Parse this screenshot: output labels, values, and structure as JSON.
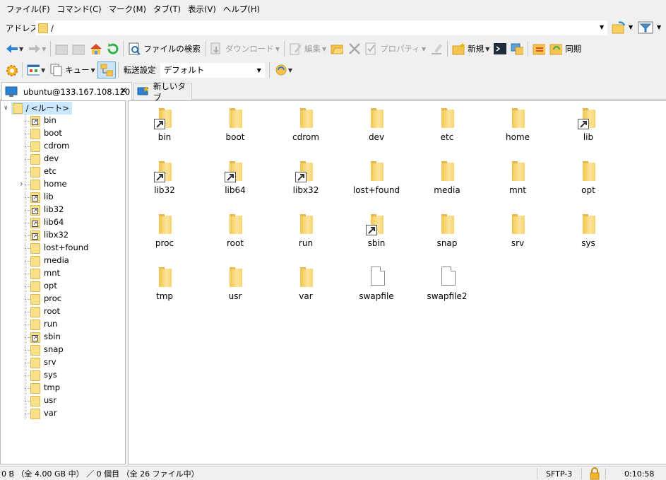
{
  "menu": [
    "ファイル(F)",
    "コマンド(C)",
    "マーク(M)",
    "タブ(T)",
    "表示(V)",
    "ヘルプ(H)"
  ],
  "address": {
    "label": "アドレス",
    "value": "/"
  },
  "toolbar": {
    "find_files": "ファイルの検索",
    "download": "ダウンロード",
    "edit": "編集",
    "properties": "プロパティ",
    "new": "新規",
    "sync": "同期",
    "queue": "キュー",
    "transfer_label": "転送設定",
    "transfer_value": "デフォルト"
  },
  "tabs": [
    {
      "label": "ubuntu@133.167.108.120",
      "active": true
    },
    {
      "label": "新しいタブ",
      "active": false
    }
  ],
  "tree": {
    "root": "/ <ルート>",
    "items": [
      {
        "name": "bin",
        "link": true
      },
      {
        "name": "boot",
        "link": false
      },
      {
        "name": "cdrom",
        "link": false
      },
      {
        "name": "dev",
        "link": false
      },
      {
        "name": "etc",
        "link": false
      },
      {
        "name": "home",
        "link": false,
        "expandable": true
      },
      {
        "name": "lib",
        "link": true
      },
      {
        "name": "lib32",
        "link": true
      },
      {
        "name": "lib64",
        "link": true
      },
      {
        "name": "libx32",
        "link": true
      },
      {
        "name": "lost+found",
        "link": false
      },
      {
        "name": "media",
        "link": false
      },
      {
        "name": "mnt",
        "link": false
      },
      {
        "name": "opt",
        "link": false
      },
      {
        "name": "proc",
        "link": false
      },
      {
        "name": "root",
        "link": false
      },
      {
        "name": "run",
        "link": false
      },
      {
        "name": "sbin",
        "link": true
      },
      {
        "name": "snap",
        "link": false
      },
      {
        "name": "srv",
        "link": false
      },
      {
        "name": "sys",
        "link": false
      },
      {
        "name": "tmp",
        "link": false
      },
      {
        "name": "usr",
        "link": false
      },
      {
        "name": "var",
        "link": false
      }
    ]
  },
  "files": [
    {
      "name": "bin",
      "type": "folder",
      "link": true
    },
    {
      "name": "boot",
      "type": "folder",
      "link": false
    },
    {
      "name": "cdrom",
      "type": "folder",
      "link": false
    },
    {
      "name": "dev",
      "type": "folder",
      "link": false
    },
    {
      "name": "etc",
      "type": "folder",
      "link": false
    },
    {
      "name": "home",
      "type": "folder",
      "link": false
    },
    {
      "name": "lib",
      "type": "folder",
      "link": true
    },
    {
      "name": "lib32",
      "type": "folder",
      "link": true
    },
    {
      "name": "lib64",
      "type": "folder",
      "link": true
    },
    {
      "name": "libx32",
      "type": "folder",
      "link": true
    },
    {
      "name": "lost+found",
      "type": "folder",
      "link": false
    },
    {
      "name": "media",
      "type": "folder",
      "link": false
    },
    {
      "name": "mnt",
      "type": "folder",
      "link": false
    },
    {
      "name": "opt",
      "type": "folder",
      "link": false
    },
    {
      "name": "proc",
      "type": "folder",
      "link": false
    },
    {
      "name": "root",
      "type": "folder",
      "link": false
    },
    {
      "name": "run",
      "type": "folder",
      "link": false
    },
    {
      "name": "sbin",
      "type": "folder",
      "link": true
    },
    {
      "name": "snap",
      "type": "folder",
      "link": false
    },
    {
      "name": "srv",
      "type": "folder",
      "link": false
    },
    {
      "name": "sys",
      "type": "folder",
      "link": false
    },
    {
      "name": "tmp",
      "type": "folder",
      "link": false
    },
    {
      "name": "usr",
      "type": "folder",
      "link": false
    },
    {
      "name": "var",
      "type": "folder",
      "link": false
    },
    {
      "name": "swapfile",
      "type": "file",
      "link": false
    },
    {
      "name": "swapfile2",
      "type": "file",
      "link": false
    }
  ],
  "status": {
    "summary": "0 B （全 4.00 GB 中） ／ 0 個目 （全 26 ファイル中）",
    "protocol": "SFTP-3",
    "time": "0:10:58"
  }
}
